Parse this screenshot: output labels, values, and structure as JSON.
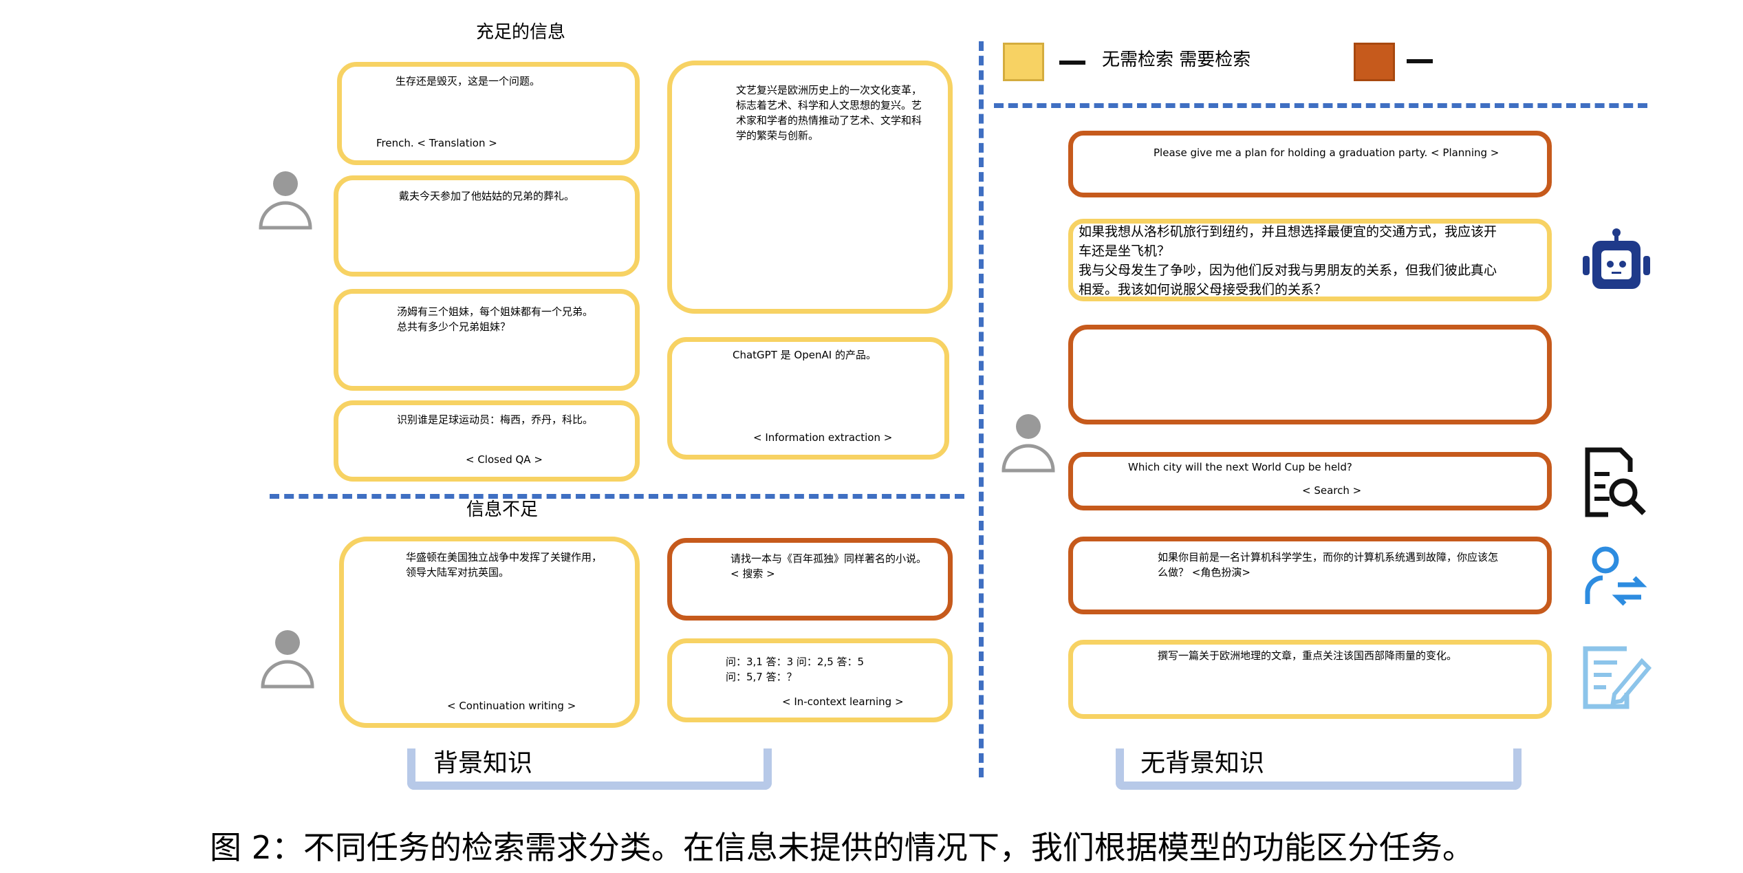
{
  "left": {
    "top_heading": "充足的信息",
    "bottom_heading": "信息不足",
    "tab_label": "背景知识",
    "cards": [
      {
        "text": "生存还是毁灭，这是一个问题。",
        "tag": "French. < Translation >"
      },
      {
        "text": "戴夫今天参加了他姑姑的兄弟的葬礼。"
      },
      {
        "text": "汤姆有三个姐妹，每个姐妹都有一个兄弟。\n总共有多少个兄弟姐妹？"
      },
      {
        "text": "识别谁是足球运动员：梅西，乔丹，科比。",
        "tag": "< Closed QA >"
      },
      {
        "text": "文艺复兴是欧洲历史上的一次文化变革，\n标志着艺术、科学和人文思想的复兴。艺\n术家和学者的热情推动了艺术、文学和科\n学的繁荣与创新。"
      },
      {
        "text": "ChatGPT 是 OpenAI 的产品。",
        "tag": "< Information extraction >"
      },
      {
        "text": "华盛顿在美国独立战争中发挥了关键作用，\n领导大陆军对抗英国。",
        "tag": "< Continuation writing >"
      },
      {
        "text": "请找一本与《百年孤独》同样著名的小说。\n< 搜索 >"
      },
      {
        "text": "问：3,1 答：3 问：2,5 答：5\n问：5,7 答：？",
        "tag": "< In-context learning >"
      }
    ]
  },
  "right": {
    "legend": {
      "label": "无需检索 需要检索",
      "no_color": "#F7D263",
      "yes_color": "#C65A1C"
    },
    "tab_label": "无背景知识",
    "cards": [
      {
        "text": "Please give me a plan for holding a graduation party. < Planning >"
      },
      {
        "text": "如果我想从洛杉矶旅行到纽约，并且想选择最便宜的交通方式，我应该开\n车还是坐飞机？\n我与父母发生了争吵，因为他们反对我与男朋友的关系，但我们彼此真心\n相爱。我该如何说服父母接受我们的关系？"
      },
      {
        "text": ""
      },
      {
        "text": "Which city will the next World Cup be held?",
        "tag": "< Search >"
      },
      {
        "text": "如果你目前是一名计算机科学学生，而你的计算机系统遇到故障，你应该怎\n么做？ <角色扮演>"
      },
      {
        "text": "撰写一篇关于欧洲地理的文章，重点关注该国西部降雨量的变化。"
      }
    ],
    "icons": [
      "robot-icon",
      "search-document-icon",
      "person-swap-icon",
      "edit-document-icon"
    ]
  },
  "caption": "图 2：不同任务的检索需求分类。在信息未提供的情况下，我们根据模型的功能区分任务。"
}
